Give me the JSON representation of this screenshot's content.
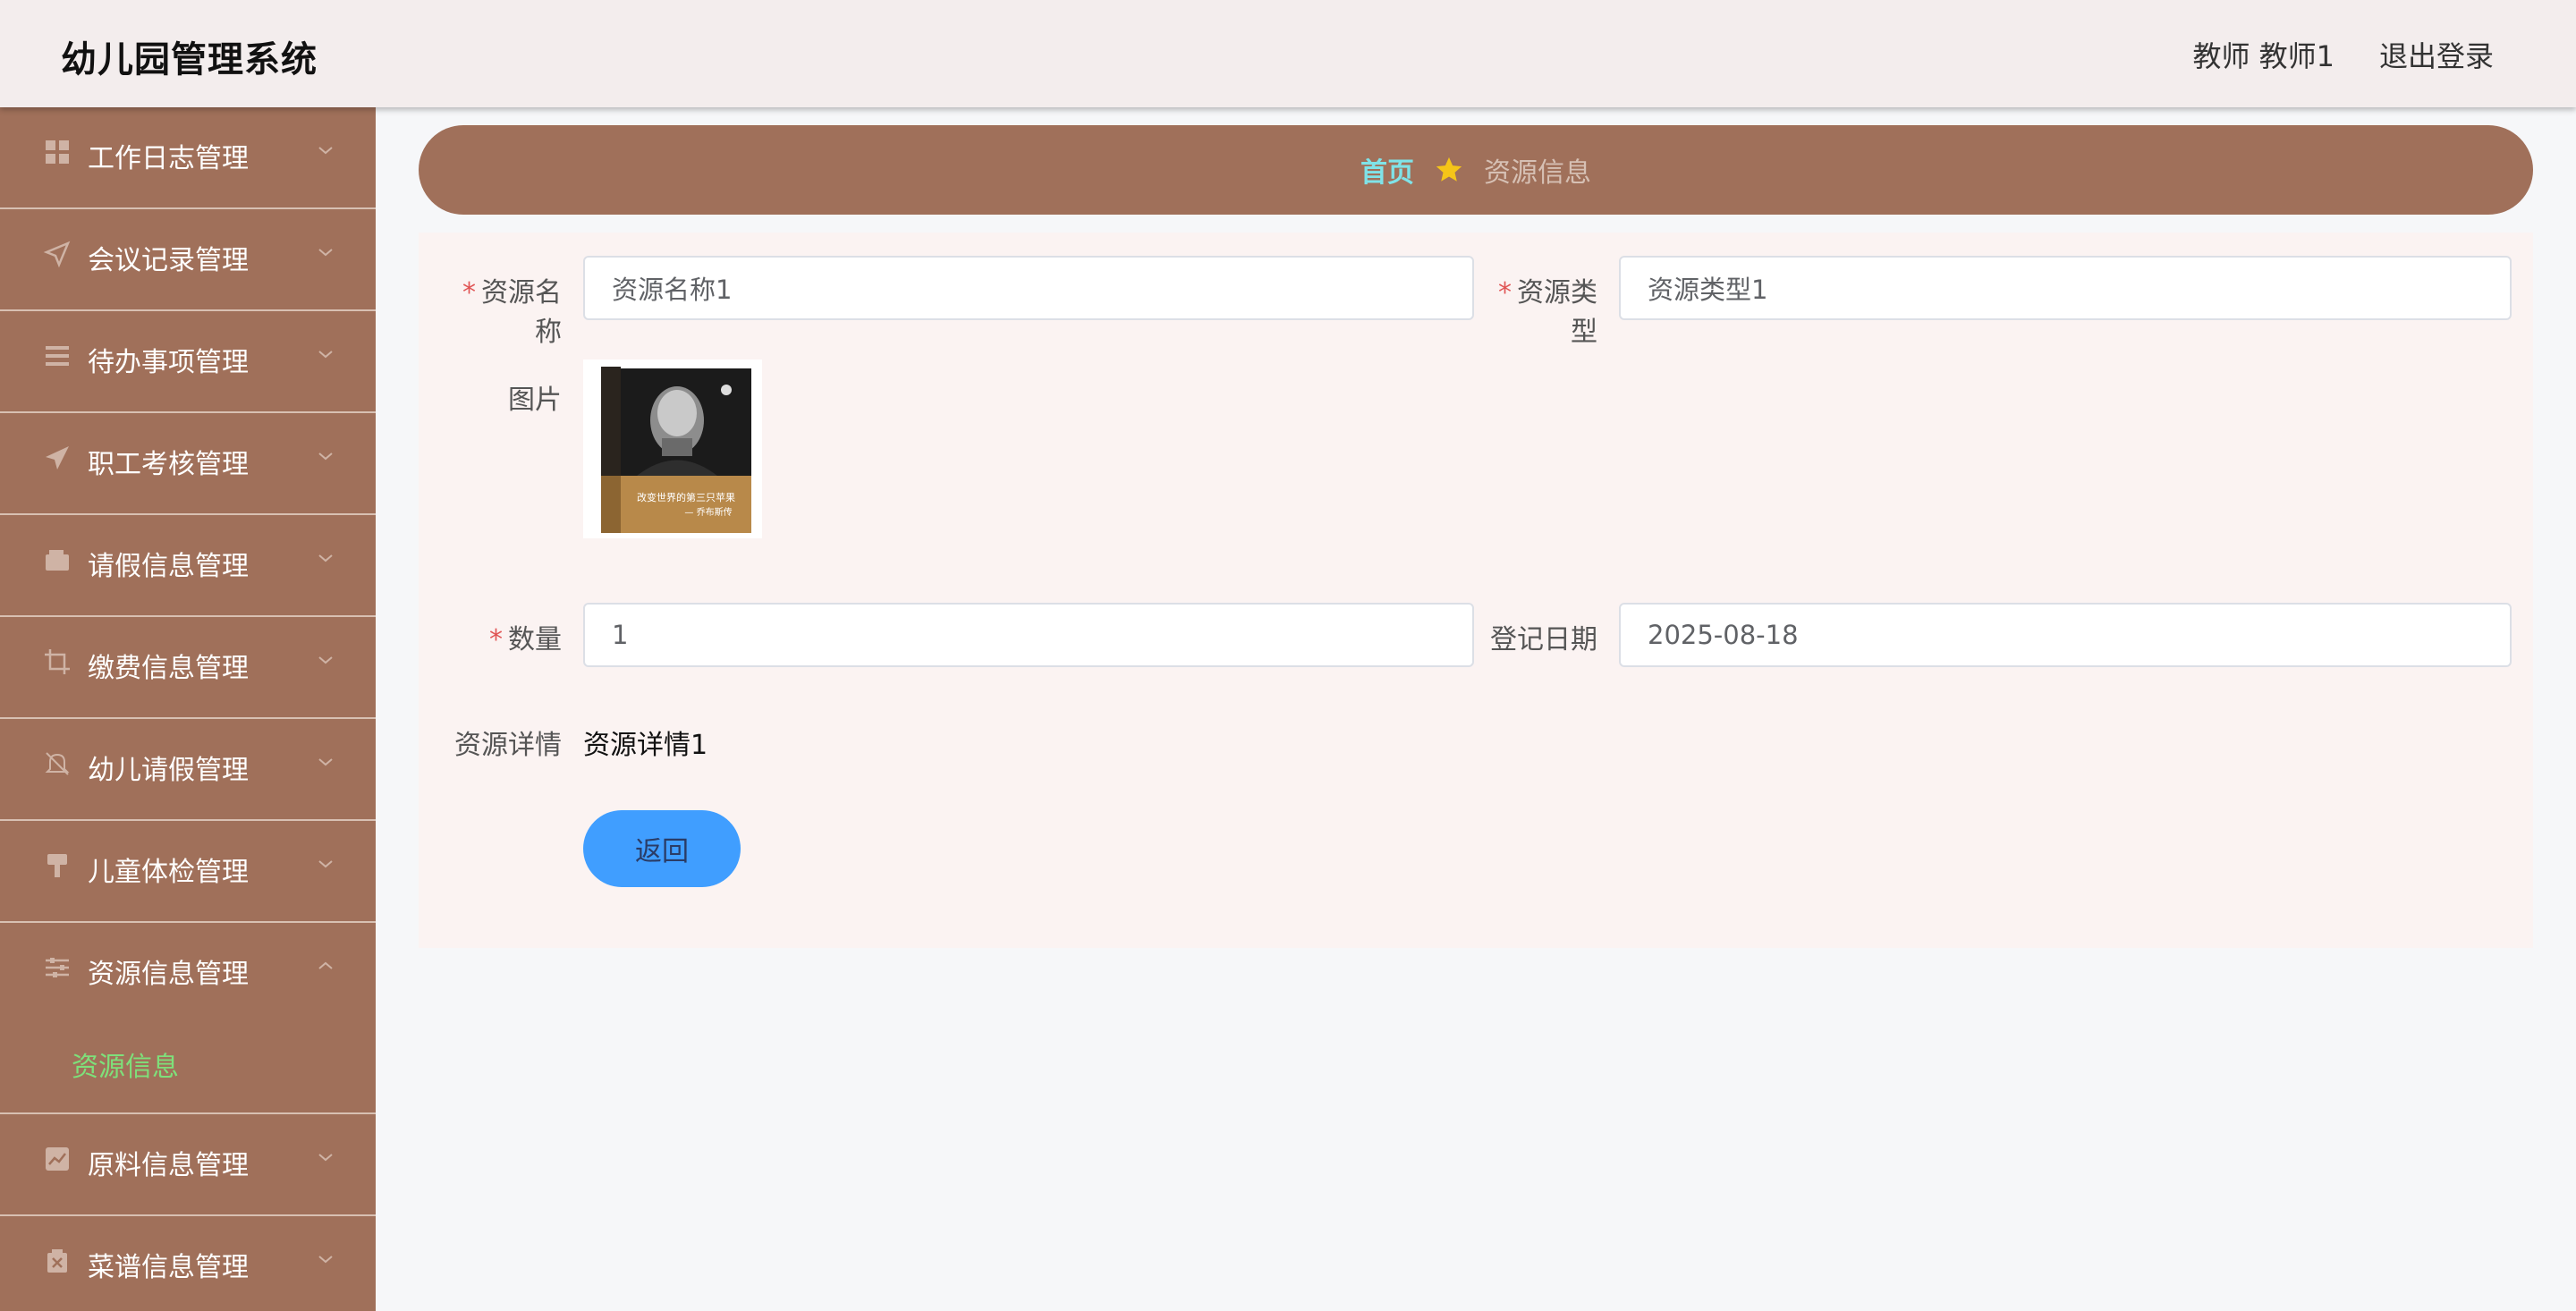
{
  "header": {
    "title": "幼儿园管理系统",
    "user": "教师 教师1",
    "logout": "退出登录"
  },
  "sidebar": {
    "items": [
      {
        "label": "工作日志管理",
        "icon": "grid-icon"
      },
      {
        "label": "会议记录管理",
        "icon": "send-outline-icon"
      },
      {
        "label": "待办事项管理",
        "icon": "list-icon"
      },
      {
        "label": "职工考核管理",
        "icon": "paper-plane-icon"
      },
      {
        "label": "请假信息管理",
        "icon": "wallet-icon"
      },
      {
        "label": "缴费信息管理",
        "icon": "crop-icon"
      },
      {
        "label": "幼儿请假管理",
        "icon": "bell-off-icon"
      },
      {
        "label": "儿童体检管理",
        "icon": "brush-icon"
      },
      {
        "label": "资源信息管理",
        "icon": "sliders-icon"
      },
      {
        "label": "原料信息管理",
        "icon": "chart-icon"
      },
      {
        "label": "菜谱信息管理",
        "icon": "box-icon"
      }
    ],
    "active_submenu": "资源信息"
  },
  "breadcrumb": {
    "home": "首页",
    "current": "资源信息"
  },
  "form": {
    "name_label": "资源名称",
    "name_value": "资源名称1",
    "type_label": "资源类型",
    "type_value": "资源类型1",
    "image_label": "图片",
    "image_text_line1": "改变世界的第三只苹果",
    "image_text_line2": "— 乔布斯传",
    "quantity_label": "数量",
    "quantity_value": "1",
    "date_label": "登记日期",
    "date_value": "2025-08-18",
    "detail_label": "资源详情",
    "detail_value": "资源详情1",
    "back_label": "返回"
  },
  "colors": {
    "sidebar_bg": "#a0705a",
    "header_bg": "#f3eded",
    "active_submenu": "#7ee07a",
    "breadcrumb_home": "#7fe3e8",
    "star": "#f5c518",
    "button": "#409eff",
    "required": "#e05555"
  }
}
